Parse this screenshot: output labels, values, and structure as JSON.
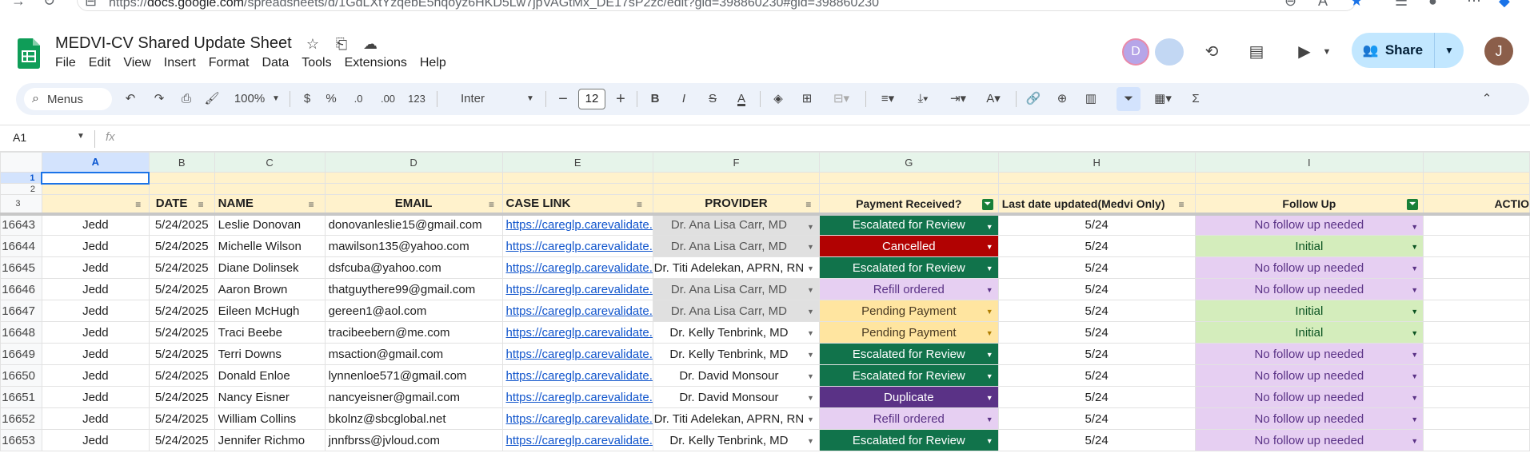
{
  "browser": {
    "url_prefix": "https://",
    "url_domain": "docs.google.com",
    "url_rest": "/spreadsheets/d/1GdLXtYzqebE5hqoyz6HKD5Lw7jpVAGtMx_DE17sP2zc/edit?gid=398860230#gid=398860230"
  },
  "doc": {
    "title": "MEDVI-CV Shared Update Sheet",
    "menu": [
      "File",
      "Edit",
      "View",
      "Insert",
      "Format",
      "Data",
      "Tools",
      "Extensions",
      "Help"
    ]
  },
  "header": {
    "avatar_d": "D",
    "share_label": "Share",
    "user_initial": "J"
  },
  "toolbar": {
    "search_label": "Menus",
    "zoom": "100%",
    "currency": "$",
    "percent": "%",
    "dec_decrease": ".0",
    "dec_increase": ".00",
    "number_format": "123",
    "font": "Inter",
    "font_size": "12",
    "bold": "B",
    "italic": "I",
    "strike": "S",
    "text_color": "A",
    "sum": "Σ"
  },
  "formula_bar": {
    "cell_ref": "A1",
    "fx": "fx"
  },
  "columns": [
    "A",
    "B",
    "C",
    "D",
    "E",
    "F",
    "G",
    "H",
    "I"
  ],
  "row_numbers": {
    "r1": "1",
    "r2": "2",
    "r3": "3"
  },
  "headers": {
    "date": "DATE",
    "name": "NAME",
    "email": "EMAIL",
    "case_link": "CASE LINK",
    "provider": "PROVIDER",
    "payment": "Payment Received?",
    "last_updated": "Last date updated(Medvi Only)",
    "follow_up": "Follow Up",
    "action": "ACTIO"
  },
  "rows": [
    {
      "num": "16643",
      "a": "Jedd",
      "date": "5/24/2025",
      "name": "Leslie Donovan",
      "email": "donovanleslie15@gmail.com",
      "link": "https://careglp.carevalidate.",
      "provider": "Dr. Ana Lisa Carr, MD",
      "payment": "Escalated for Review",
      "updated": "5/24",
      "follow": "No follow up needed"
    },
    {
      "num": "16644",
      "a": "Jedd",
      "date": "5/24/2025",
      "name": "Michelle Wilson",
      "email": "mawilson135@yahoo.com",
      "link": "https://careglp.carevalidate.",
      "provider": "Dr. Ana Lisa Carr, MD",
      "payment": "Cancelled",
      "updated": "5/24",
      "follow": "Initial"
    },
    {
      "num": "16645",
      "a": "Jedd",
      "date": "5/24/2025",
      "name": "Diane Dolinsek",
      "email": "dsfcuba@yahoo.com",
      "link": "https://careglp.carevalidate.",
      "provider": "Dr. Titi Adelekan, APRN, RN",
      "payment": "Escalated for Review",
      "updated": "5/24",
      "follow": "No follow up needed"
    },
    {
      "num": "16646",
      "a": "Jedd",
      "date": "5/24/2025",
      "name": "Aaron Brown",
      "email": "thatguythere99@gmail.com",
      "link": "https://careglp.carevalidate.",
      "provider": "Dr. Ana Lisa Carr, MD",
      "payment": "Refill ordered",
      "updated": "5/24",
      "follow": "No follow up needed"
    },
    {
      "num": "16647",
      "a": "Jedd",
      "date": "5/24/2025",
      "name": "Eileen McHugh",
      "email": "gereen1@aol.com",
      "link": "https://careglp.carevalidate.",
      "provider": "Dr. Ana Lisa Carr, MD",
      "payment": "Pending Payment",
      "updated": "5/24",
      "follow": "Initial"
    },
    {
      "num": "16648",
      "a": "Jedd",
      "date": "5/24/2025",
      "name": "Traci Beebe",
      "email": "tracibeebern@me.com",
      "link": "https://careglp.carevalidate.",
      "provider": "Dr. Kelly Tenbrink, MD",
      "payment": "Pending Payment",
      "updated": "5/24",
      "follow": "Initial"
    },
    {
      "num": "16649",
      "a": "Jedd",
      "date": "5/24/2025",
      "name": "Terri Downs",
      "email": "msaction@gmail.com",
      "link": "https://careglp.carevalidate.",
      "provider": "Dr. Kelly Tenbrink, MD",
      "payment": "Escalated for Review",
      "updated": "5/24",
      "follow": "No follow up needed"
    },
    {
      "num": "16650",
      "a": "Jedd",
      "date": "5/24/2025",
      "name": "Donald Enloe",
      "email": "lynnenloe571@gmail.com",
      "link": "https://careglp.carevalidate.",
      "provider": "Dr. David Monsour",
      "payment": "Escalated for Review",
      "updated": "5/24",
      "follow": "No follow up needed"
    },
    {
      "num": "16651",
      "a": "Jedd",
      "date": "5/24/2025",
      "name": "Nancy Eisner",
      "email": "nancyeisner@gmail.com",
      "link": "https://careglp.carevalidate.",
      "provider": "Dr. David Monsour",
      "payment": "Duplicate",
      "updated": "5/24",
      "follow": "No follow up needed"
    },
    {
      "num": "16652",
      "a": "Jedd",
      "date": "5/24/2025",
      "name": "William Collins",
      "email": "bkolnz@sbcglobal.net",
      "link": "https://careglp.carevalidate.",
      "provider": "Dr. Titi Adelekan, APRN, RN",
      "payment": "Refill ordered",
      "updated": "5/24",
      "follow": "No follow up needed"
    },
    {
      "num": "16653",
      "a": "Jedd",
      "date": "5/24/2025",
      "name": "Jennifer Richmo",
      "email": "jnnfbrss@jvloud.com",
      "link": "https://careglp.carevalidate.",
      "provider": "Dr. Kelly Tenbrink, MD",
      "payment": "Escalated for Review",
      "updated": "5/24",
      "follow": "No follow up needed"
    }
  ],
  "colors": {
    "escalated": "#11734b",
    "cancelled": "#b10202",
    "refill": "#e6cff2",
    "pending": "#ffe5a0",
    "duplicate": "#5a3286",
    "followup_none": "#e6cff2",
    "followup_initial": "#d4edbc",
    "header_row": "#fff2cc"
  }
}
